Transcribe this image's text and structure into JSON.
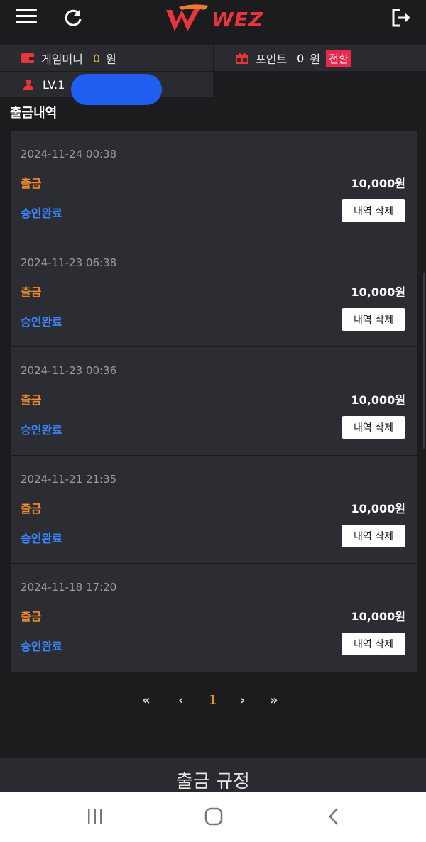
{
  "header": {
    "logo_text": "WEZ"
  },
  "wallet": {
    "money_label": "게임머니",
    "money_value": "0",
    "money_unit": "원",
    "point_label": "포인트",
    "point_value": "0",
    "point_unit": "원",
    "convert_label": "전환",
    "level": "LV.1"
  },
  "page_title": "출금내역",
  "records": [
    {
      "date": "2024-11-24 00:38",
      "type": "출금",
      "amount": "10,000원",
      "status": "승인완료",
      "delete_label": "내역 삭제"
    },
    {
      "date": "2024-11-23 06:38",
      "type": "출금",
      "amount": "10,000원",
      "status": "승인완료",
      "delete_label": "내역 삭제"
    },
    {
      "date": "2024-11-23 00:36",
      "type": "출금",
      "amount": "10,000원",
      "status": "승인완료",
      "delete_label": "내역 삭제"
    },
    {
      "date": "2024-11-21 21:35",
      "type": "출금",
      "amount": "10,000원",
      "status": "승인완료",
      "delete_label": "내역 삭제"
    },
    {
      "date": "2024-11-18 17:20",
      "type": "출금",
      "amount": "10,000원",
      "status": "승인완료",
      "delete_label": "내역 삭제"
    }
  ],
  "pagination": {
    "first": "«",
    "prev": "‹",
    "current": "1",
    "next": "›",
    "last": "»"
  },
  "footer": {
    "rules_label": "출금 규정"
  },
  "colors": {
    "accent_red": "#e8343c",
    "money_yellow": "#f2c53b",
    "withdraw_orange": "#f08a2e",
    "status_blue": "#3a86ff",
    "convert_pink": "#e8294f"
  }
}
